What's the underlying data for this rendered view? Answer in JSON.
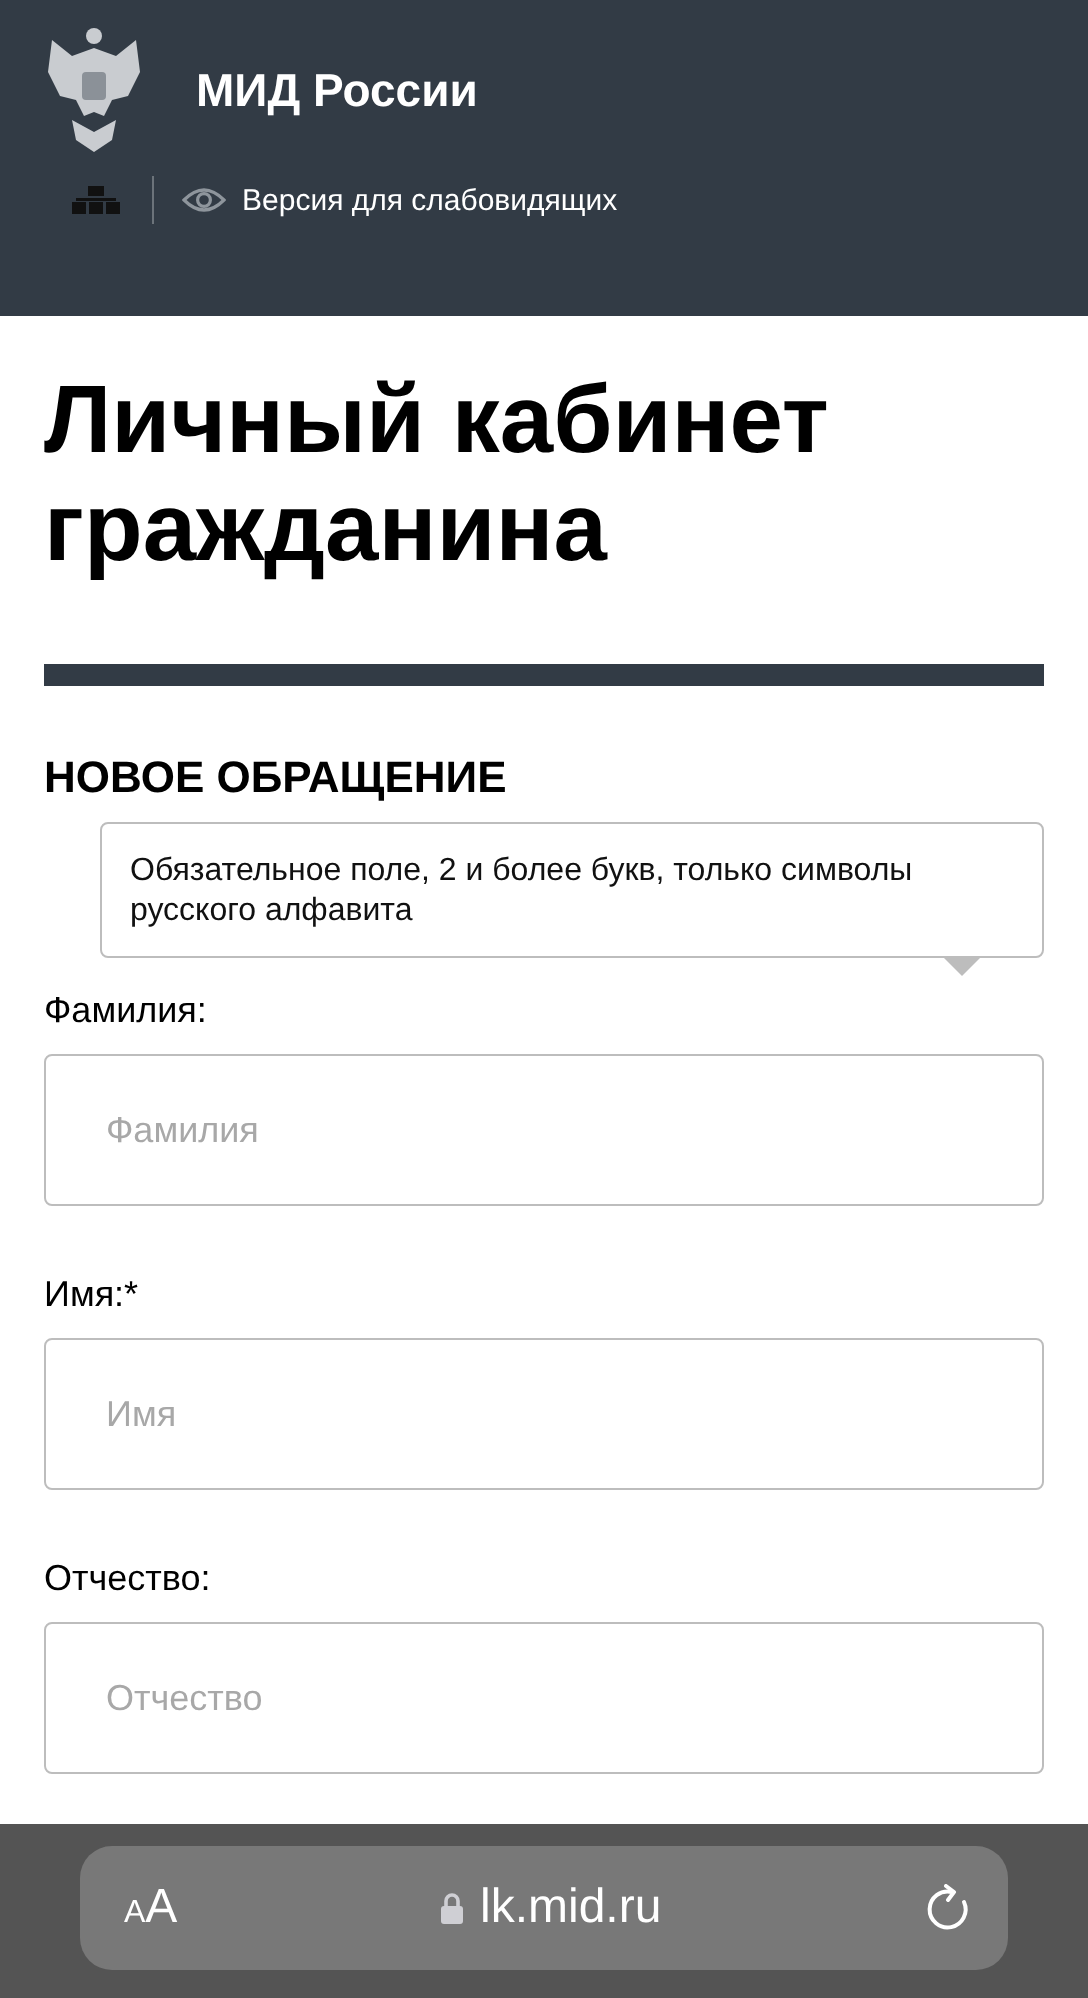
{
  "header": {
    "title": "МИД России",
    "accessibility_link": "Версия для слабовидящих"
  },
  "page_title": "Личный кабинет гражданина",
  "section_title": "НОВОЕ ОБРАЩЕНИЕ",
  "tooltip": "Обязательное поле, 2 и более букв, только символы русского алфавита",
  "fields": [
    {
      "label": "Фамилия:",
      "placeholder": "Фамилия"
    },
    {
      "label": "Имя:*",
      "placeholder": "Имя"
    },
    {
      "label": "Отчество:",
      "placeholder": "Отчество"
    }
  ],
  "browser_bar": {
    "text_size": "AA",
    "url": "lk.mid.ru"
  }
}
